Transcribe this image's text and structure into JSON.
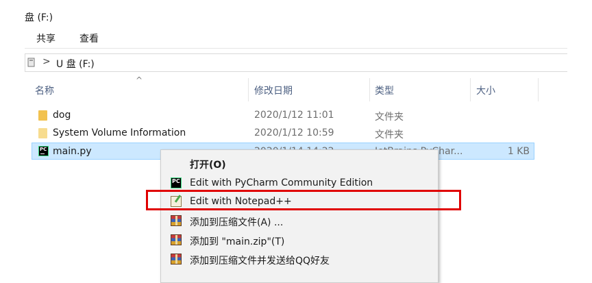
{
  "window": {
    "title": "盘 (F:)"
  },
  "ribbon": {
    "tabs": [
      "共享",
      "查看"
    ]
  },
  "address_bar": {
    "chevron": ">",
    "path": "U 盘 (F:)",
    "icon": "drive-icon"
  },
  "columns": {
    "sort_indicator": "^",
    "name": "名称",
    "date": "修改日期",
    "type": "类型",
    "size": "大小"
  },
  "files": [
    {
      "name": "dog",
      "date": "2020/1/12 11:01",
      "type": "文件夹",
      "size": "",
      "icon": "folder-icon"
    },
    {
      "name": "System Volume Information",
      "date": "2020/1/12 10:59",
      "type": "文件夹",
      "size": "",
      "icon": "folder-icon"
    },
    {
      "name": "main.py",
      "date": "2020/1/14 14:22",
      "type": "JetBrains PyChar...",
      "size": "1 KB",
      "icon": "pycharm-file-icon",
      "selected": true
    }
  ],
  "context_menu": {
    "items": [
      {
        "label": "打开(O)",
        "icon": "",
        "bold": true
      },
      {
        "label": "Edit with PyCharm Community Edition",
        "icon": "pycharm-icon"
      },
      {
        "label": "Edit with Notepad++",
        "icon": "notepadpp-icon"
      },
      {
        "label": "添加到压缩文件(A) ...",
        "icon": "winrar-icon"
      },
      {
        "label": "添加到 \"main.zip\"(T)",
        "icon": "winrar-icon"
      },
      {
        "label": "添加到压缩文件并发送给QQ好友",
        "icon": "winrar-icon"
      }
    ]
  },
  "highlight": {
    "target": "Edit with Notepad++",
    "color": "#e00000"
  },
  "colors": {
    "selection_bg": "#cce8ff",
    "selection_border": "#99d1ff",
    "header_text": "#4d6082",
    "folder": "#f2c24f"
  }
}
